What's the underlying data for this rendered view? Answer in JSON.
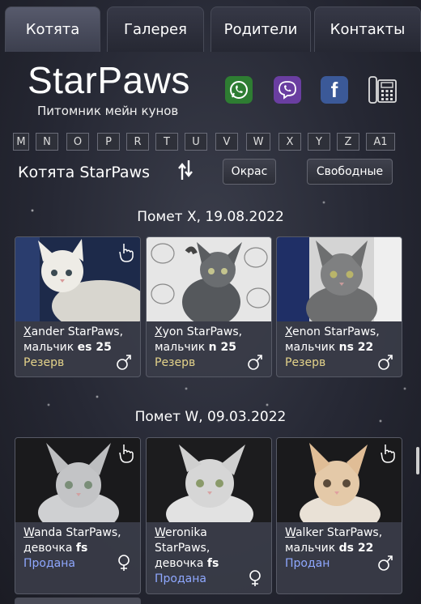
{
  "nav": {
    "tabs": [
      {
        "label": "Котята",
        "active": true
      },
      {
        "label": "Галерея"
      },
      {
        "label": "Родители"
      },
      {
        "label": "Контакты"
      }
    ]
  },
  "header": {
    "logo": "StarPaws",
    "tagline": "Питомник мейн кунов",
    "social": [
      "whatsapp-icon",
      "viber-icon",
      "facebook-icon",
      "phone-icon"
    ],
    "facebook_glyph": "f"
  },
  "alphabet": [
    "M",
    "N",
    "O",
    "P",
    "R",
    "T",
    "U",
    "V",
    "W",
    "X",
    "Y",
    "Z",
    "A1"
  ],
  "section": {
    "title": "Котята StarPaws",
    "filter_color": "Окрас",
    "filter_free": "Свободные"
  },
  "litters": [
    {
      "title": "Помет X, 19.08.2022",
      "kittens": [
        {
          "initial": "X",
          "name_rest": "ander StarPaws,",
          "sex_text": "мальчик ",
          "code": "es 25",
          "status": "Резерв",
          "status_type": "reserve",
          "gender": "male"
        },
        {
          "initial": "X",
          "name_rest": "yon StarPaws,",
          "sex_text": "мальчик ",
          "code": "n 25",
          "status": "Резерв",
          "status_type": "reserve",
          "gender": "male"
        },
        {
          "initial": "X",
          "name_rest": "enon StarPaws,",
          "sex_text": "мальчик ",
          "code": "ns 22",
          "status": "Резерв",
          "status_type": "reserve",
          "gender": "male"
        }
      ]
    },
    {
      "title": "Помет W, 09.03.2022",
      "kittens": [
        {
          "initial": "W",
          "name_rest": "anda StarPaws,",
          "sex_text": "девочка ",
          "code": "fs",
          "status": "Продана",
          "status_type": "sold",
          "gender": "female"
        },
        {
          "initial": "W",
          "name_rest": "eronika",
          "name_line2": "StarPaws,",
          "sex_text": "девочка ",
          "code": "fs",
          "status": "Продана",
          "status_type": "sold",
          "gender": "female"
        },
        {
          "initial": "W",
          "name_rest": "alker StarPaws,",
          "sex_text": "мальчик ",
          "code": "ds 22",
          "status": "Продан",
          "status_type": "sold",
          "gender": "male"
        }
      ]
    }
  ],
  "colors": {
    "reserve": "#e4d38a",
    "sold": "#8fa8ff",
    "card_bg": "#3a3c48"
  }
}
